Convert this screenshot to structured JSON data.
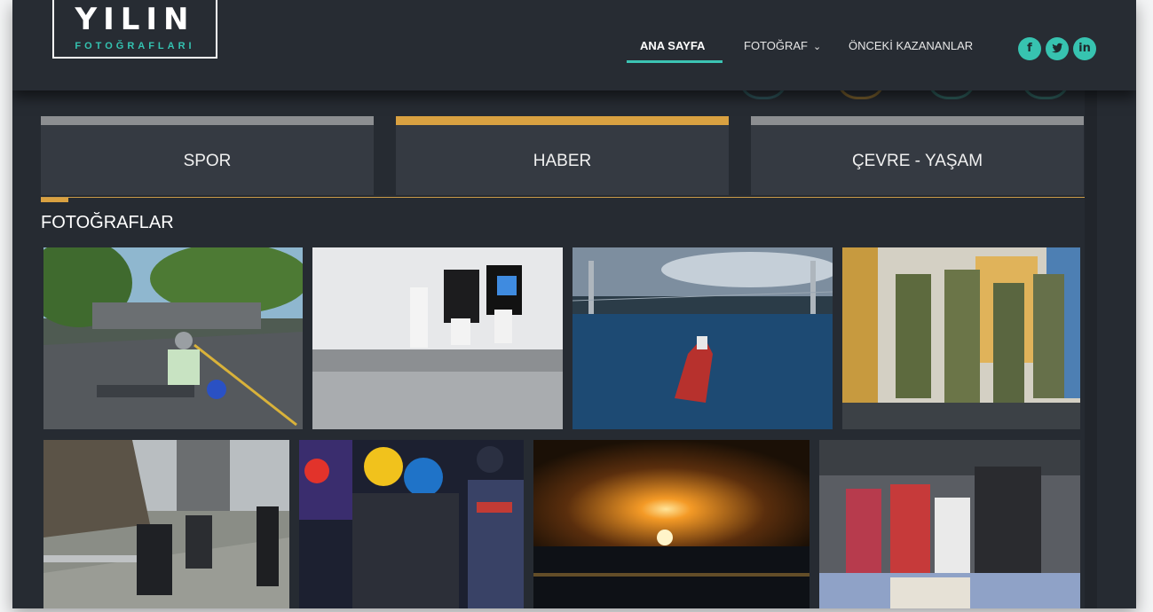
{
  "logo": {
    "main": "YILIN",
    "sub": "FOTOĞRAFLARI"
  },
  "nav": {
    "home": "ANA SAYFA",
    "photo": "FOTOĞRAF",
    "photo_chevron": "chevron-down-icon",
    "winners": "ÖNCEKİ KAZANANLAR"
  },
  "social": [
    {
      "icon": "facebook-icon",
      "glyph": "f"
    },
    {
      "icon": "twitter-icon",
      "glyph": "t"
    },
    {
      "icon": "linkedin-icon",
      "glyph": "in"
    }
  ],
  "categories": [
    {
      "label": "SPOR",
      "active": false
    },
    {
      "label": "HABER",
      "active": true
    },
    {
      "label": "ÇEVRE - YAŞAM",
      "active": false
    }
  ],
  "section_title": "FOTOĞRAFLAR",
  "colors": {
    "accent": "#3cc4b4",
    "active_tab": "#d9a141",
    "inactive_tab": "#8c8e91",
    "background": "#262b32"
  }
}
